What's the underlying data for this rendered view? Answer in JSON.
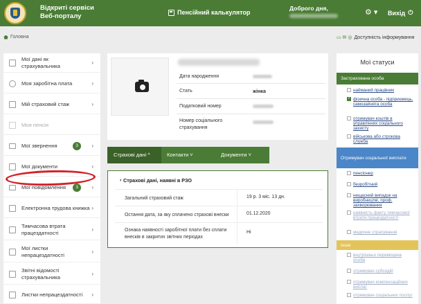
{
  "header": {
    "brand_line1": "Відкриті сервіси",
    "brand_line2": "Веб-порталу",
    "center_link": "Пенсійний калькулятор",
    "greeting": "Доброго дня,",
    "gear_symbol": "⚙ ▾",
    "logout_label": "Вихід"
  },
  "breadcrumb": {
    "home": "Головна",
    "info_link": "Доступність інформування"
  },
  "sidebar": {
    "items": [
      {
        "label": "Мої дані як страхувальника",
        "chevron": "›"
      },
      {
        "label": "Моя заробітна плата",
        "chevron": "›"
      },
      {
        "label": "Мій страховий стаж",
        "chevron": "›"
      },
      {
        "label": "Моя пенсія",
        "chevron": ""
      },
      {
        "label": "Мої звернення",
        "badge": "3",
        "chevron": "›"
      },
      {
        "label": "Мої документи",
        "chevron": "›"
      },
      {
        "label": "Мої повідомлення",
        "badge": "3",
        "chevron": "›"
      },
      {
        "label": "Електронна трудова книжка",
        "chevron": "›"
      },
      {
        "label": "Тимчасова втрата працездатності",
        "chevron": "›"
      },
      {
        "label": "Мої листки непрацездатності",
        "chevron": "›"
      },
      {
        "label": "Звітні відомості страхувальника",
        "chevron": "›"
      },
      {
        "label": "Листки непрацездатності",
        "chevron": "›"
      }
    ]
  },
  "profile": {
    "rows": [
      {
        "label": "Дата народження",
        "value": ""
      },
      {
        "label": "Стать",
        "value": "жінка"
      },
      {
        "label": "Податковий номер",
        "value": ""
      },
      {
        "label": "Номер соціального страхування",
        "value": ""
      }
    ]
  },
  "tabs": [
    {
      "label": "Страхові дані ^"
    },
    {
      "label": "Контакти ˅"
    },
    {
      "label": "Документи ˅"
    }
  ],
  "content": {
    "title": "Страхові дані, наявні в РЗО",
    "rows": [
      {
        "label": "Загальний страховий стаж",
        "value": "19 р. 3 міс. 13 дн."
      },
      {
        "label": "Остання дата, за яку сплачено страхові внески",
        "value": "01.12.2020"
      },
      {
        "label": "Ознака наявності заробітної плати без сплати внесків в закритих звітних періодах",
        "value": "Ні"
      }
    ]
  },
  "statuses": {
    "title": "Мої статуси",
    "group1": {
      "header": "Застрахована особа",
      "color": "#4a7c35",
      "items": [
        {
          "label": "найманий працівник",
          "checked": false
        },
        {
          "label": "фізична особа - підприємець, самозайнята особа",
          "checked": true
        },
        {
          "label": "отримувач коштів в управліннях соціального захисту",
          "checked": false
        },
        {
          "label": "військова або строкова служба",
          "checked": false
        }
      ]
    },
    "group2": {
      "header": "Отримувач соціальної виплати",
      "color": "#4a86c8",
      "items": [
        {
          "label": "пенсіонер",
          "checked": false
        },
        {
          "label": "безробітний",
          "checked": false
        },
        {
          "label": "нещасний випадок на виробництві, проф. захворювання",
          "checked": false
        },
        {
          "label": "наявність факту тимчасової втрати працездатності",
          "checked": false
        },
        {
          "label": "медичне страхування",
          "checked": false
        }
      ]
    },
    "group3": {
      "header": "Інше",
      "color": "#e3c45a",
      "items": [
        {
          "label": "внутрішньо переміщена особа",
          "checked": false
        },
        {
          "label": "отримувач субсидій",
          "checked": false
        },
        {
          "label": "отримувач компенсаційних виплат",
          "checked": false
        },
        {
          "label": "отримувач соціальних послуг",
          "checked": false
        }
      ]
    }
  }
}
